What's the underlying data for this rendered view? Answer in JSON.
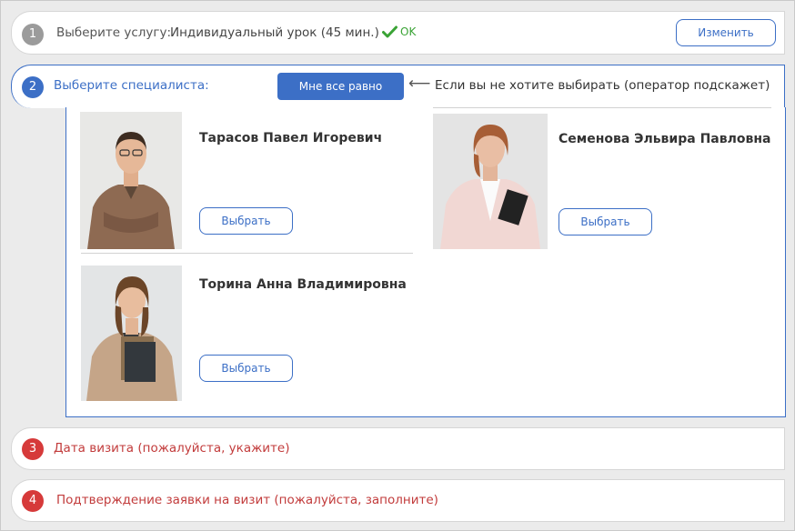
{
  "step1": {
    "number": "1",
    "label": "Выберите услугу:",
    "value": "Индивидуальный урок (45 мин.)",
    "status": "OK",
    "status_icon": "checkmark-icon",
    "change_label": "Изменить"
  },
  "step2": {
    "number": "2",
    "label": "Выберите специалиста:",
    "any_label": "Мне все равно",
    "arrow": "⟵",
    "hint": "Если вы не хотите выбирать (оператор подскажет)"
  },
  "specialists": [
    {
      "name": "Тарасов Павел Игоревич",
      "select_label": "Выбрать"
    },
    {
      "name": "Семенова Эльвира Павловна",
      "select_label": "Выбрать"
    },
    {
      "name": "Торина Анна Владимировна",
      "select_label": "Выбрать"
    }
  ],
  "step3": {
    "number": "3",
    "label": "Дата визита (пожалуйста, укажите)"
  },
  "step4": {
    "number": "4",
    "label": "Подтверждение заявки на визит (пожалуйста, заполните)"
  },
  "colors": {
    "primary": "#3c6fc6",
    "ok": "#3aa335",
    "required": "#c23b3b",
    "step_done": "#9b9b9b",
    "step_pending": "#d63a3a"
  }
}
